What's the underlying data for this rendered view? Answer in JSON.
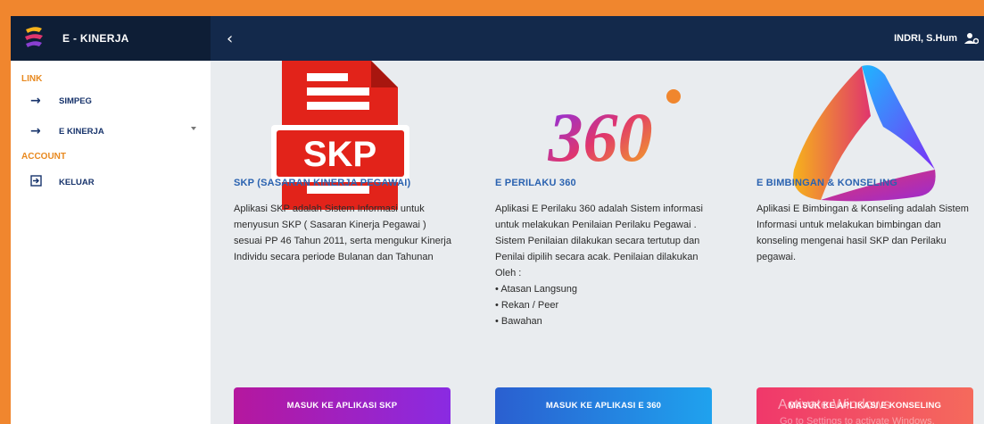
{
  "brand": {
    "title": "E - KINERJA"
  },
  "header": {
    "user_name": "INDRI, S.Hum"
  },
  "sidebar": {
    "sections": [
      {
        "label": "LINK"
      },
      {
        "label": "ACCOUNT"
      }
    ],
    "items": [
      {
        "label": "SIMPEG"
      },
      {
        "label": "E KINERJA"
      },
      {
        "label": "KELUAR"
      }
    ]
  },
  "cards": [
    {
      "logo_text": "SKP",
      "title": "SKP (SASARAN KINERJA PEGAWAI)",
      "desc": "Aplikasi SKP adalah Sistem Informasi untuk menyusun SKP ( Sasaran Kinerja Pegawai ) sesuai PP 46 Tahun 2011, serta mengukur Kinerja Individu secara periode Bulanan dan Tahunan",
      "button": "MASUK KE APLIKASI SKP",
      "button_color": "#b5179e"
    },
    {
      "logo_text": "360",
      "title": "E PERILAKU 360",
      "desc": "Aplikasi E Perilaku 360 adalah Sistem informasi untuk melakukan Penilaian Perilaku Pegawai . Sistem Penilaian dilakukan secara tertutup dan Penilai dipilih secara acak. Penilaian dilakukan Oleh :",
      "list": [
        "Atasan Langsung",
        "Rekan / Peer",
        "Bawahan"
      ],
      "button": "MASUK KE APLIKASI E 360",
      "button_color": "#2f6fd6"
    },
    {
      "title": "E BIMBINGAN & KONSELING",
      "desc": "Aplikasi E Bimbingan & Konseling adalah Sistem Informasi untuk melakukan bimbingan dan konseling mengenai hasil SKP dan Perilaku pegawai.",
      "button": "MASUK KE APLIKASI E KONSELING",
      "button_color": "#f0386b"
    }
  ],
  "watermark": {
    "line1": "Activate Windows",
    "line2": "Go to Settings to activate Windows."
  },
  "colors": {
    "accent": "#e8891f",
    "nav_dark": "#0e1e36",
    "topbar": "#13294b",
    "link_blue": "#2a62b0"
  }
}
